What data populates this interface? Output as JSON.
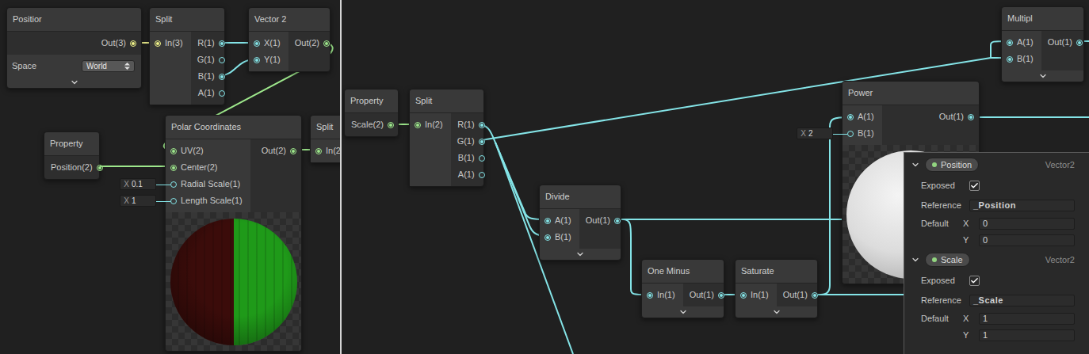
{
  "panels": [
    {
      "name": "left",
      "nodes": [
        {
          "title": "Positior",
          "kind": "position",
          "inputs": [],
          "outputs": [
            {
              "label": "Out(3)",
              "connected": true,
              "color": "#f2f58a"
            }
          ],
          "space": {
            "label": "Space",
            "value": "World"
          },
          "collapsible": true
        },
        {
          "title": "Split",
          "kind": "basic",
          "inputs": [
            {
              "label": "In(3)",
              "connected": true,
              "color": "#f2f58a"
            }
          ],
          "outputs": [
            {
              "label": "R(1)",
              "connected": true,
              "color": "#84e4e7"
            },
            {
              "label": "G(1)",
              "connected": false,
              "color": "#84e4e7"
            },
            {
              "label": "B(1)",
              "connected": true,
              "color": "#84e4e7"
            },
            {
              "label": "A(1)",
              "connected": false,
              "color": "#84e4e7"
            }
          ],
          "collapsible": false
        },
        {
          "title": "Vector 2",
          "kind": "basic",
          "inputs": [
            {
              "label": "X(1)",
              "connected": true,
              "color": "#84e4e7"
            },
            {
              "label": "Y(1)",
              "connected": true,
              "color": "#84e4e7"
            }
          ],
          "outputs": [
            {
              "label": "Out(2)",
              "connected": true,
              "color": "#9ee88c"
            }
          ],
          "collapsible": false
        },
        {
          "title": "Property",
          "kind": "basic",
          "inputs": [],
          "outputs": [
            {
              "label": "Position(2)",
              "connected": true,
              "color": "#9ee88c"
            }
          ],
          "collapsible": false
        },
        {
          "title": "Polar Coordinates",
          "kind": "preview",
          "preview": "polar",
          "inputs": [
            {
              "label": "UV(2)",
              "connected": true,
              "color": "#9ee88c"
            },
            {
              "label": "Center(2)",
              "connected": true,
              "color": "#9ee88c"
            },
            {
              "label": "Radial Scale(1)",
              "connected": false,
              "color": "#84e4e7",
              "field": {
                "axis": "X",
                "value": "0.1"
              }
            },
            {
              "label": "Length Scale(1)",
              "connected": false,
              "color": "#84e4e7",
              "field": {
                "axis": "X",
                "value": "1"
              }
            }
          ],
          "outputs": [
            {
              "label": "Out(2)",
              "connected": true,
              "color": "#9ee88c"
            }
          ],
          "collapsible": false
        },
        {
          "title": "Split",
          "kind": "basic",
          "inputs": [
            {
              "label": "In(2",
              "connected": true,
              "color": "#9ee88c"
            }
          ],
          "outputs": [],
          "collapsible": false
        }
      ]
    },
    {
      "name": "right",
      "nodes": [
        {
          "title": "Property",
          "kind": "basic",
          "inputs": [],
          "outputs": [
            {
              "label": "Scale(2)",
              "connected": true,
              "color": "#9ee88c"
            }
          ],
          "collapsible": false
        },
        {
          "title": "Split",
          "kind": "basic",
          "inputs": [
            {
              "label": "In(2)",
              "connected": true,
              "color": "#9ee88c"
            }
          ],
          "outputs": [
            {
              "label": "R(1)",
              "connected": true,
              "color": "#84e4e7"
            },
            {
              "label": "G(1)",
              "connected": true,
              "color": "#84e4e7"
            },
            {
              "label": "B(1)",
              "connected": false,
              "color": "#84e4e7"
            },
            {
              "label": "A(1)",
              "connected": false,
              "color": "#84e4e7"
            }
          ],
          "collapsible": false
        },
        {
          "title": "Divide",
          "kind": "basic",
          "inputs": [
            {
              "label": "A(1)",
              "connected": true,
              "color": "#84e4e7"
            },
            {
              "label": "B(1)",
              "connected": true,
              "color": "#84e4e7"
            }
          ],
          "outputs": [
            {
              "label": "Out(1)",
              "connected": true,
              "color": "#84e4e7"
            }
          ],
          "collapsible": true
        },
        {
          "title": "One Minus",
          "kind": "basic",
          "inputs": [
            {
              "label": "In(1)",
              "connected": true,
              "color": "#84e4e7"
            }
          ],
          "outputs": [
            {
              "label": "Out(1)",
              "connected": true,
              "color": "#84e4e7"
            }
          ],
          "collapsible": true
        },
        {
          "title": "Saturate",
          "kind": "basic",
          "inputs": [
            {
              "label": "In(1)",
              "connected": true,
              "color": "#84e4e7"
            }
          ],
          "outputs": [
            {
              "label": "Out(1)",
              "connected": true,
              "color": "#84e4e7"
            }
          ],
          "collapsible": true
        },
        {
          "title": "Power",
          "kind": "preview",
          "preview": "sphere",
          "inputs": [
            {
              "label": "A(1)",
              "connected": true,
              "color": "#84e4e7"
            },
            {
              "label": "B(1)",
              "connected": false,
              "color": "#84e4e7",
              "field": {
                "axis": "X",
                "value": "2"
              }
            }
          ],
          "outputs": [
            {
              "label": "Out(1)",
              "connected": true,
              "color": "#84e4e7"
            }
          ],
          "collapsible": false
        },
        {
          "title": "Multipl",
          "kind": "basic",
          "inputs": [
            {
              "label": "A(1)",
              "connected": true,
              "color": "#84e4e7"
            },
            {
              "label": "B(1)",
              "connected": true,
              "color": "#84e4e7"
            }
          ],
          "outputs": [
            {
              "label": "Out(1)",
              "connected": true,
              "color": "#84e4e7"
            }
          ],
          "collapsible": true
        }
      ],
      "blackboard": {
        "labels": {
          "exposed": "Exposed",
          "reference": "Reference",
          "default": "Default"
        },
        "properties": [
          {
            "name": "Position",
            "type": "Vector2",
            "expanded": true,
            "exposed": true,
            "reference": "_Position",
            "default": [
              {
                "axis": "X",
                "value": "0"
              },
              {
                "axis": "Y",
                "value": "0"
              }
            ]
          },
          {
            "name": "Scale",
            "type": "Vector2",
            "expanded": true,
            "exposed": true,
            "reference": "_Scale",
            "default": [
              {
                "axis": "X",
                "value": "1"
              },
              {
                "axis": "Y",
                "value": "1"
              }
            ]
          }
        ]
      }
    }
  ]
}
